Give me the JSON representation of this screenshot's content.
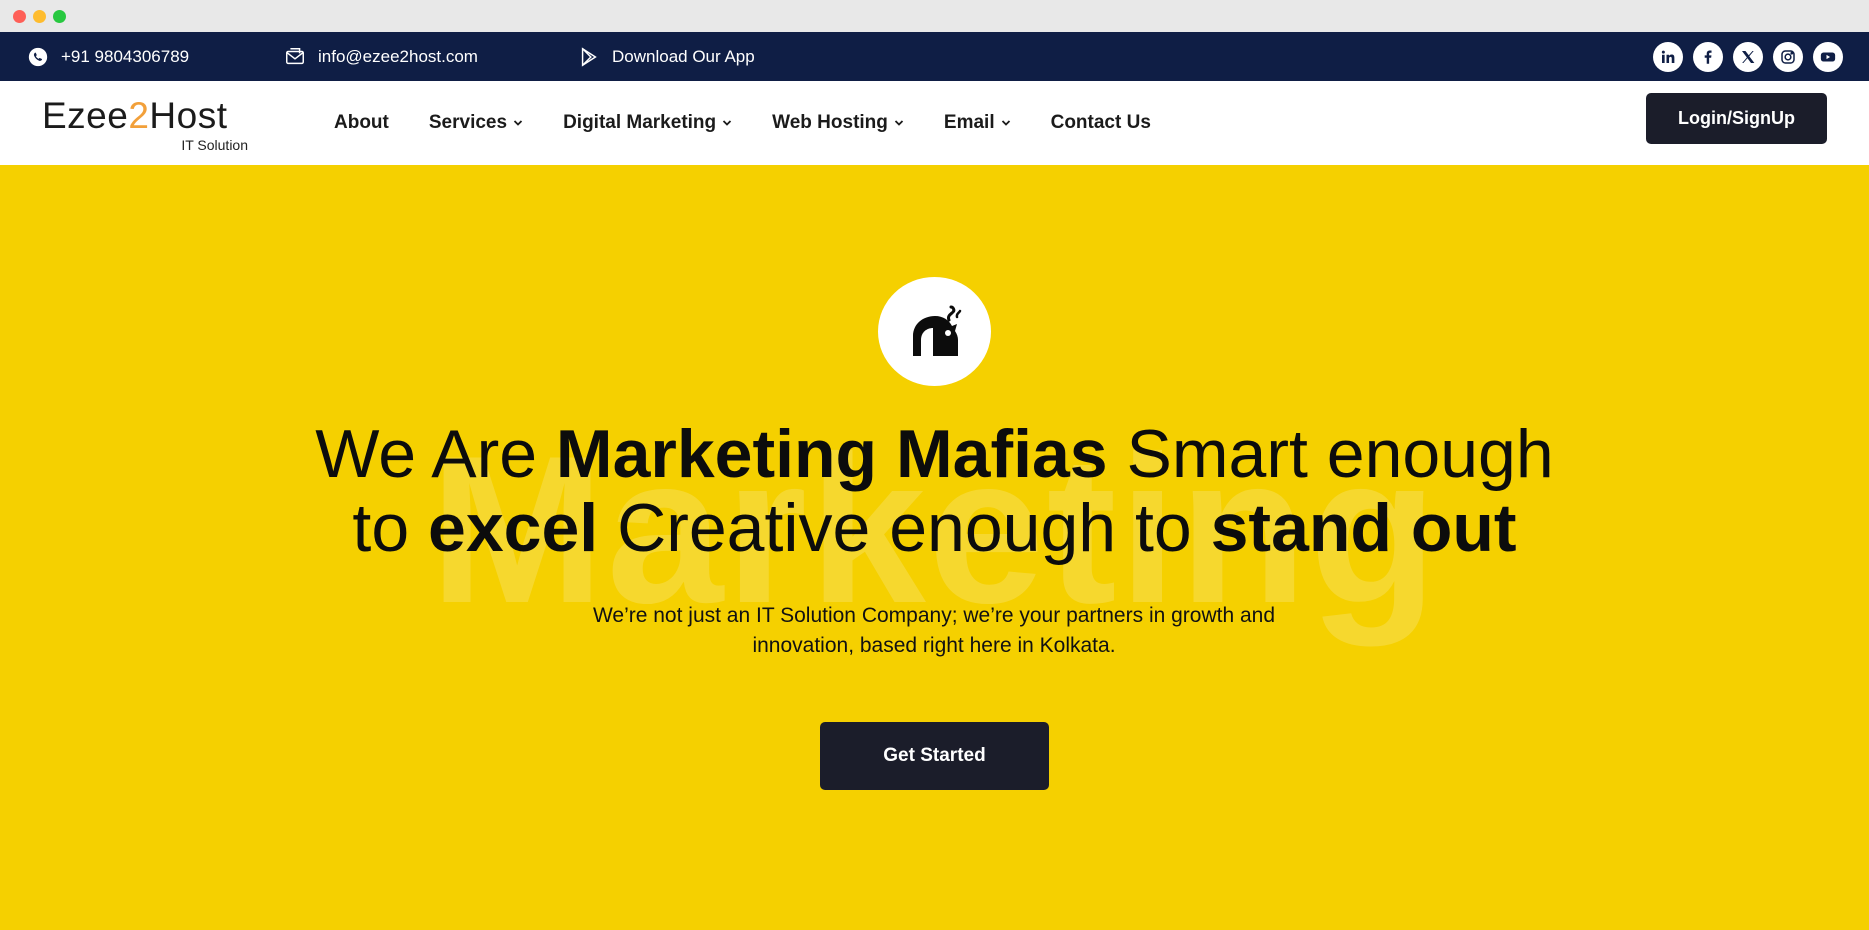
{
  "topbar": {
    "phone": "+91 9804306789",
    "email": "info@ezee2host.com",
    "app_label": "Download Our App",
    "socials": [
      "linkedin-icon",
      "facebook-icon",
      "x-icon",
      "instagram-icon",
      "youtube-icon"
    ]
  },
  "logo": {
    "main_a": "Ezee",
    "main_two": "2",
    "main_b": "Host",
    "sub": "IT Solution"
  },
  "nav": {
    "items": [
      {
        "label": "About"
      },
      {
        "label": "Services"
      },
      {
        "label": "Digital Marketing"
      },
      {
        "label": "Web Hosting"
      },
      {
        "label": "Email"
      },
      {
        "label": "Contact Us"
      }
    ],
    "login_label": "Login/SignUp"
  },
  "hero": {
    "watermark": "Marketing",
    "headline": {
      "p1": "We Are ",
      "b1": "Marketing Mafias",
      "p2": " Smart enough",
      "p3": "to ",
      "b2": "excel",
      "p4": " Creative enough to ",
      "b3": "stand out"
    },
    "subtext_line1": "We’re not just an IT Solution Company; we’re your partners in growth and",
    "subtext_line2": "innovation, based right here in Kolkata.",
    "cta_label": "Get Started"
  },
  "colors": {
    "topbar": "#0f1e45",
    "hero_bg": "#f5d000",
    "button_dark": "#1b1d2a",
    "logo_accent": "#f2a03a"
  }
}
